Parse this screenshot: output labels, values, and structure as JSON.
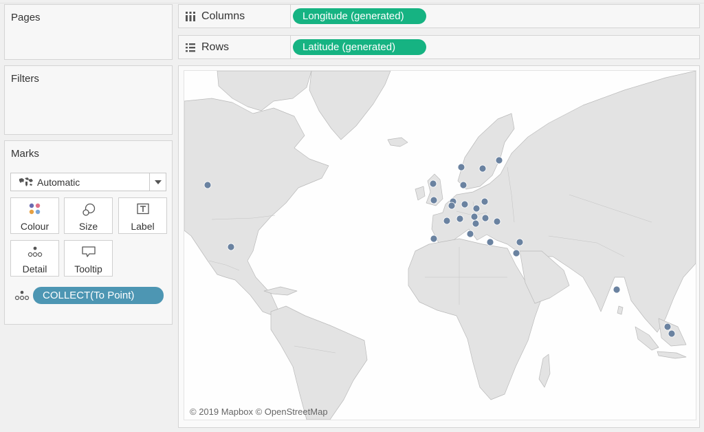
{
  "cards": {
    "pages": {
      "title": "Pages"
    },
    "filters": {
      "title": "Filters"
    },
    "marks": {
      "title": "Marks",
      "mark_type": "Automatic",
      "buttons": [
        {
          "label": "Colour",
          "icon": "colour-icon"
        },
        {
          "label": "Size",
          "icon": "size-icon"
        },
        {
          "label": "Label",
          "icon": "label-icon"
        },
        {
          "label": "Detail",
          "icon": "detail-icon"
        },
        {
          "label": "Tooltip",
          "icon": "tooltip-icon"
        }
      ],
      "detail_pill": "COLLECT(To Point)"
    }
  },
  "shelves": {
    "columns": {
      "label": "Columns",
      "pill": "Longitude (generated)"
    },
    "rows": {
      "label": "Rows",
      "pill": "Latitude (generated)"
    }
  },
  "map": {
    "attribution": "© 2019 Mapbox © OpenStreetMap",
    "land_color": "#e3e3e3",
    "water_color": "#fefefe",
    "mark_color": "#6a82a0"
  },
  "colors": {
    "pill_green": "#16b382",
    "pill_blue": "#4d96b3"
  }
}
